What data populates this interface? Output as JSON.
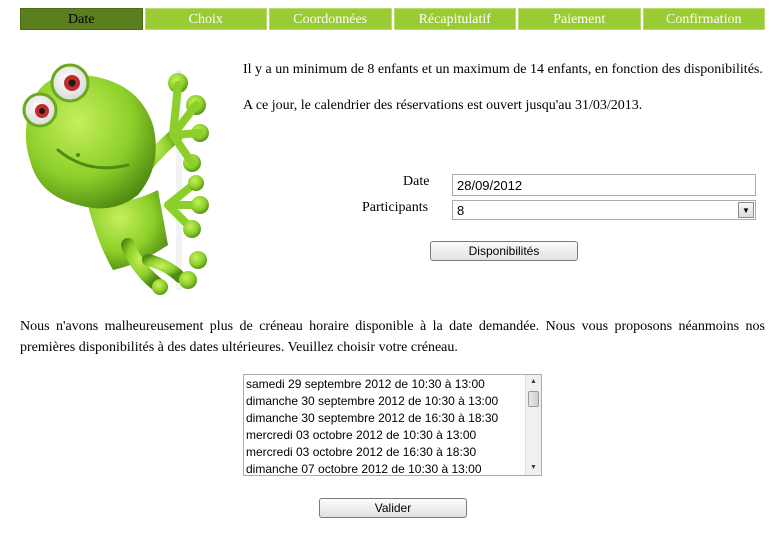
{
  "steps": [
    {
      "label": "Date",
      "active": true
    },
    {
      "label": "Choix",
      "active": false
    },
    {
      "label": "Coordonnées",
      "active": false
    },
    {
      "label": "Récapitulatif",
      "active": false
    },
    {
      "label": "Paiement",
      "active": false
    },
    {
      "label": "Confirmation",
      "active": false
    }
  ],
  "intro": {
    "p1": "Il y a un minimum de 8 enfants et un maximum de 14 enfants, en fonction des disponibilités.",
    "p2": "A ce jour, le calendrier des réservations est ouvert jusqu'au 31/03/2013."
  },
  "form": {
    "date_label": "Date",
    "date_value": "28/09/2012",
    "participants_label": "Participants",
    "participants_value": "8",
    "dispo_button": "Disponibilités"
  },
  "message": "Nous n'avons malheureusement plus de créneau horaire disponible à la date demandée. Nous vous proposons néanmoins nos premières disponibilités à des dates ultérieures. Veuillez choisir votre créneau.",
  "slots": [
    "samedi 29 septembre 2012 de 10:30 à 13:00",
    "dimanche 30 septembre 2012 de 10:30 à 13:00",
    "dimanche 30 septembre 2012 de 16:30 à 18:30",
    "mercredi 03 octobre 2012 de 10:30 à 13:00",
    "mercredi 03 octobre 2012 de 16:30 à 18:30",
    "dimanche 07 octobre 2012 de 10:30 à 13:00"
  ],
  "validate_button": "Valider",
  "colors": {
    "step_bg": "#99cc33",
    "step_active_bg": "#5c7f1e",
    "gecko_green": "#8ccf2a"
  },
  "icons": {
    "gecko": "gecko-mascot-illustration",
    "dropdown": "chevron-down-icon"
  }
}
